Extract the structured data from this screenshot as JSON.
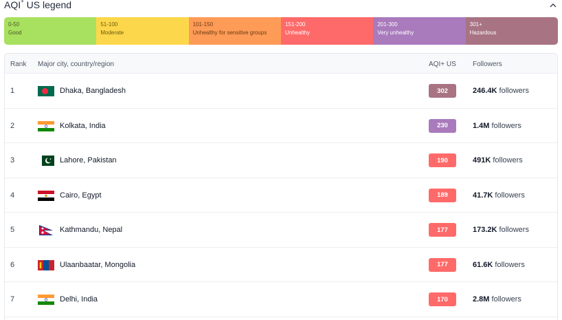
{
  "legend": {
    "title": "AQI",
    "title_sup": "+",
    "title_rest": " US legend",
    "segments": [
      {
        "range": "0-50",
        "label": "Good",
        "color": "#a8e05f",
        "text_color": "#4a5a20"
      },
      {
        "range": "51-100",
        "label": "Moderate",
        "color": "#fdd74b",
        "text_color": "#6b5a10"
      },
      {
        "range": "101-150",
        "label": "Unhealthy for sensitive groups",
        "color": "#fe9b57",
        "text_color": "#6b3a10"
      },
      {
        "range": "151-200",
        "label": "Unhealthy",
        "color": "#fe6a69",
        "text_color": "#ffffff"
      },
      {
        "range": "201-300",
        "label": "Very unhealthy",
        "color": "#a97abc",
        "text_color": "#ffffff"
      },
      {
        "range": "301+",
        "label": "Hazardous",
        "color": "#a87383",
        "text_color": "#ffffff"
      }
    ]
  },
  "table": {
    "headers": {
      "rank": "Rank",
      "city": "Major city, country/region",
      "aqi": "AQI+ US",
      "followers": "Followers"
    },
    "rows": [
      {
        "rank": "1",
        "city": "Dhaka, Bangladesh",
        "flag": "bangladesh-flag",
        "aqi": "302",
        "aqi_color": "#a87383",
        "followers": "246.4K",
        "followers_suffix": "followers"
      },
      {
        "rank": "2",
        "city": "Kolkata, India",
        "flag": "india-flag",
        "aqi": "230",
        "aqi_color": "#a97abc",
        "followers": "1.4M",
        "followers_suffix": "followers"
      },
      {
        "rank": "3",
        "city": "Lahore, Pakistan",
        "flag": "pakistan-flag",
        "aqi": "190",
        "aqi_color": "#fe6a69",
        "followers": "491K",
        "followers_suffix": "followers"
      },
      {
        "rank": "4",
        "city": "Cairo, Egypt",
        "flag": "egypt-flag",
        "aqi": "189",
        "aqi_color": "#fe6a69",
        "followers": "41.7K",
        "followers_suffix": "followers"
      },
      {
        "rank": "5",
        "city": "Kathmandu, Nepal",
        "flag": "nepal-flag",
        "aqi": "177",
        "aqi_color": "#fe6a69",
        "followers": "173.2K",
        "followers_suffix": "followers"
      },
      {
        "rank": "6",
        "city": "Ulaanbaatar, Mongolia",
        "flag": "mongolia-flag",
        "aqi": "177",
        "aqi_color": "#fe6a69",
        "followers": "61.6K",
        "followers_suffix": "followers"
      },
      {
        "rank": "7",
        "city": "Delhi, India",
        "flag": "india-flag",
        "aqi": "170",
        "aqi_color": "#fe6a69",
        "followers": "2.8M",
        "followers_suffix": "followers"
      }
    ]
  }
}
